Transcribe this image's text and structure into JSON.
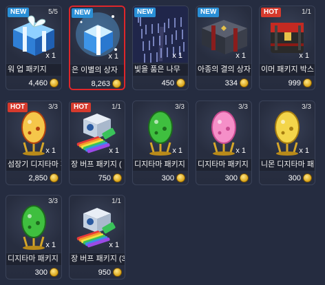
{
  "items": [
    {
      "badge": "NEW",
      "stock": "5/5",
      "mult": "x 1",
      "name": "워 업 패키지",
      "price": "4,460",
      "icon": "blue-gift-box-icon"
    },
    {
      "badge": "NEW",
      "stock": "",
      "mult": "x 1",
      "name": "은 이별의 상자",
      "price": "8,263",
      "icon": "sparkling-blue-box-icon",
      "selected": true
    },
    {
      "badge": "NEW",
      "stock": "",
      "mult": "x 1",
      "name": "빛을 품은 나무",
      "price": "450",
      "icon": "glowing-tree-icon"
    },
    {
      "badge": "NEW",
      "stock": "",
      "mult": "x 1",
      "name": "아종의 결의 상자",
      "price": "334",
      "icon": "dark-ribbon-box-icon"
    },
    {
      "badge": "HOT",
      "stock": "1/1",
      "mult": "x 1",
      "name": "이머 패키지 박스",
      "price": "999",
      "icon": "red-chest-icon"
    },
    {
      "badge": "HOT",
      "stock": "3/3",
      "mult": "x 1",
      "name": "섬장기 디지타마 패",
      "price": "2,850",
      "icon": "gold-egg-icon"
    },
    {
      "badge": "HOT",
      "stock": "1/1",
      "mult": "x 1",
      "name": "장 버프 패키지 (",
      "price": "750",
      "icon": "buff-package-icon"
    },
    {
      "badge": "",
      "stock": "3/3",
      "mult": "x 1",
      "name": "디지타마 패키지",
      "price": "300",
      "icon": "green-egg-icon"
    },
    {
      "badge": "",
      "stock": "3/3",
      "mult": "x 1",
      "name": "디지타마 패키지",
      "price": "300",
      "icon": "pink-egg-icon"
    },
    {
      "badge": "",
      "stock": "3/3",
      "mult": "x 1",
      "name": "니몬 디지타마 패",
      "price": "300",
      "icon": "yellow-egg-icon"
    },
    {
      "badge": "",
      "stock": "3/3",
      "mult": "x 1",
      "name": "디지타마 패키지",
      "price": "300",
      "icon": "green-egg-icon"
    },
    {
      "badge": "",
      "stock": "1/1",
      "mult": "x 1",
      "name": "장 버프 패키지 (3",
      "price": "950",
      "icon": "buff-package-icon"
    }
  ]
}
